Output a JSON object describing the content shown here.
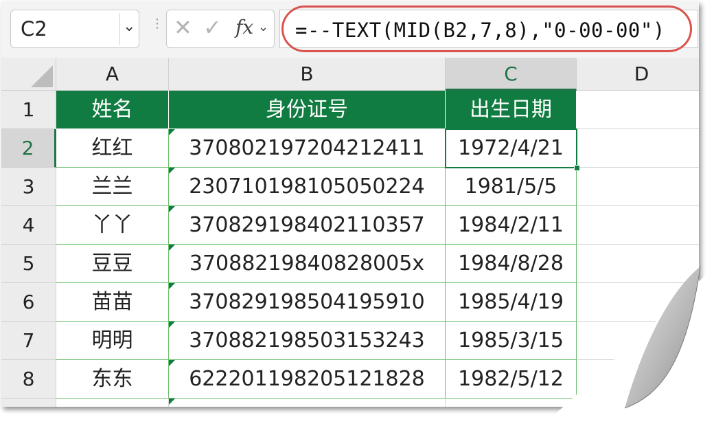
{
  "name_box": {
    "value": "C2",
    "dropdown_icon": "chevron-down-icon"
  },
  "formula_bar": {
    "cancel_icon": "close-icon",
    "enter_icon": "check-icon",
    "fx_label": "fx",
    "formula": "=--TEXT(MID(B2,7,8),\"0-00-00\")"
  },
  "columns": [
    "A",
    "B",
    "C",
    "D"
  ],
  "rows": [
    "1",
    "2",
    "3",
    "4",
    "5",
    "6",
    "7",
    "8"
  ],
  "table": {
    "headers": [
      "姓名",
      "身份证号",
      "出生日期"
    ],
    "records": [
      {
        "name": "红红",
        "id": "370802197204212411",
        "birth": "1972/4/21"
      },
      {
        "name": "兰兰",
        "id": "230710198105050224",
        "birth": "1981/5/5"
      },
      {
        "name": "丫丫",
        "id": "370829198402110357",
        "birth": "1984/2/11"
      },
      {
        "name": "豆豆",
        "id": "37088219840828005x",
        "birth": "1984/8/28"
      },
      {
        "name": "苗苗",
        "id": "370829198504195910",
        "birth": "1985/4/19"
      },
      {
        "name": "明明",
        "id": "370882198503153243",
        "birth": "1985/3/15"
      },
      {
        "name": "东东",
        "id": "622201198205121828",
        "birth": "1982/5/12"
      }
    ]
  },
  "active_cell": "C2",
  "colors": {
    "header_fill": "#107c41",
    "header_text": "#ffffff",
    "accent": "#217346",
    "highlight_ring": "#d9534f"
  }
}
